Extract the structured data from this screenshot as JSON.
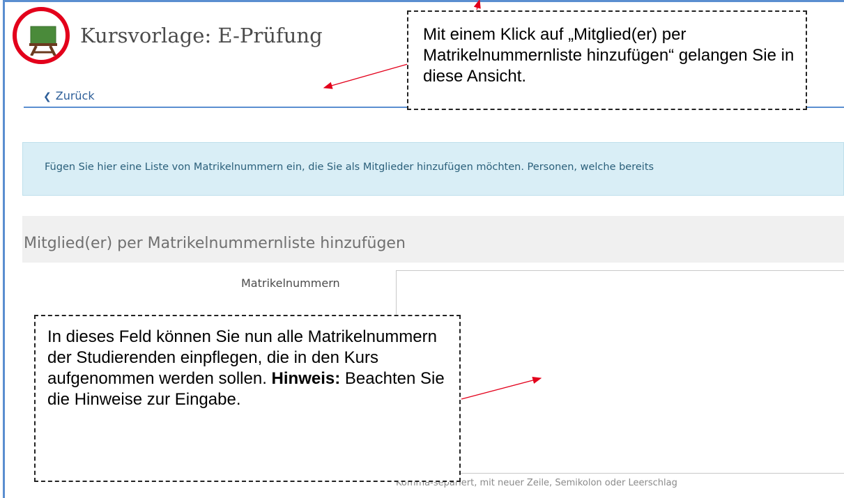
{
  "header": {
    "course_title": "Kursvorlage: E-Prüfung",
    "back_label": "Zurück"
  },
  "info": {
    "text": "Fügen Sie hier eine Liste von Matrikelnummern ein, die Sie als Mitglieder hinzufügen möchten. Personen, welche bereits"
  },
  "form": {
    "legend": "Mitglied(er) per Matrikelnummernliste hinzufügen",
    "field_label": "Matrikelnummern",
    "field_value": "",
    "field_hint": "Komma-separiert, mit neuer Zeile, Semikolon oder Leerschlag"
  },
  "annotations": {
    "top_callout": "Mit einem Klick auf „Mitglied(er) per Matrikelnummernliste hinzufügen“ gelangen Sie in diese Ansicht.",
    "bottom_callout_text": "In dieses Feld können Sie nun alle Matrikelnummern der Studierenden einpflegen, die in den Kurs aufgenommen werden sollen.",
    "bottom_callout_bold": "Hinweis:",
    "bottom_callout_tail": "Beachten Sie die Hinweise zur Eingabe."
  },
  "icons": {
    "course_icon": "blackboard-easel-icon",
    "back_icon": "chevron-left-icon"
  },
  "colors": {
    "accent_blue": "#5a8ed0",
    "link_blue": "#2e5f99",
    "info_bg": "#d9eef6",
    "highlight_red": "#e3001b",
    "arrow_red": "#e3001b",
    "board_green": "#4a8a3a",
    "easel_brown": "#6b3a1f"
  }
}
